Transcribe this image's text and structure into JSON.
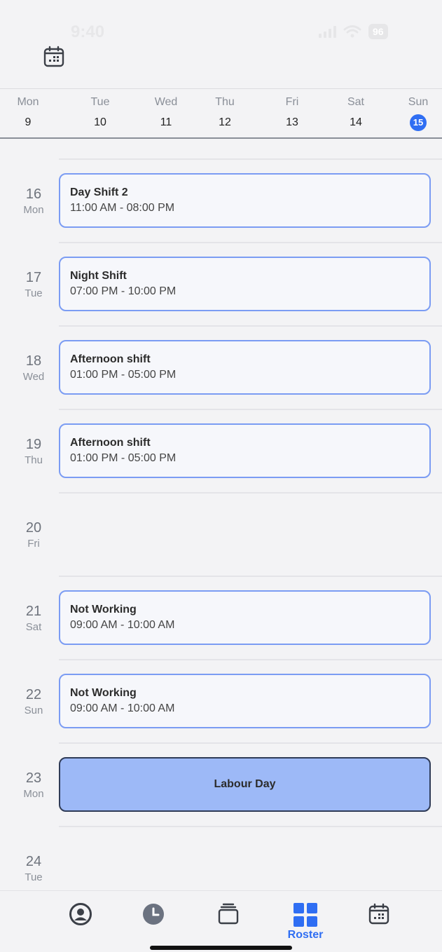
{
  "status_bar": {
    "time": "9:40",
    "battery": "96"
  },
  "week": [
    {
      "name": "Mon",
      "num": "9",
      "today": false
    },
    {
      "name": "Tue",
      "num": "10",
      "today": false
    },
    {
      "name": "Wed",
      "num": "11",
      "today": false
    },
    {
      "name": "Thu",
      "num": "12",
      "today": false
    },
    {
      "name": "Fri",
      "num": "13",
      "today": false
    },
    {
      "name": "Sat",
      "num": "14",
      "today": false
    },
    {
      "name": "Sun",
      "num": "15",
      "today": true
    }
  ],
  "rows": [
    {
      "num": "16",
      "dow": "Mon",
      "shift": {
        "title": "Day Shift 2",
        "time": "11:00 AM - 08:00 PM"
      }
    },
    {
      "num": "17",
      "dow": "Tue",
      "shift": {
        "title": "Night Shift",
        "time": "07:00 PM - 10:00 PM"
      }
    },
    {
      "num": "18",
      "dow": "Wed",
      "shift": {
        "title": "Afternoon shift",
        "time": "01:00 PM - 05:00 PM"
      }
    },
    {
      "num": "19",
      "dow": "Thu",
      "shift": {
        "title": "Afternoon shift",
        "time": "01:00 PM - 05:00 PM"
      }
    },
    {
      "num": "20",
      "dow": "Fri",
      "shift": null
    },
    {
      "num": "21",
      "dow": "Sat",
      "shift": {
        "title": "Not Working",
        "time": "09:00 AM - 10:00 AM"
      }
    },
    {
      "num": "22",
      "dow": "Sun",
      "shift": {
        "title": "Not Working",
        "time": "09:00 AM - 10:00 AM"
      }
    },
    {
      "num": "23",
      "dow": "Mon",
      "holiday": "Labour Day"
    },
    {
      "num": "24",
      "dow": "Tue",
      "shift": null
    }
  ],
  "nav": {
    "items": [
      {
        "icon": "profile-icon"
      },
      {
        "icon": "clock-icon"
      },
      {
        "icon": "layers-icon"
      },
      {
        "icon": "roster-grid-icon",
        "label": "Roster",
        "active": true
      },
      {
        "icon": "calendar-icon"
      }
    ],
    "active_color": "#2f6ef3"
  },
  "colors": {
    "accent": "#2f6ef3",
    "card_border": "#7b9cf3",
    "holiday_bg": "#9db9f7"
  }
}
